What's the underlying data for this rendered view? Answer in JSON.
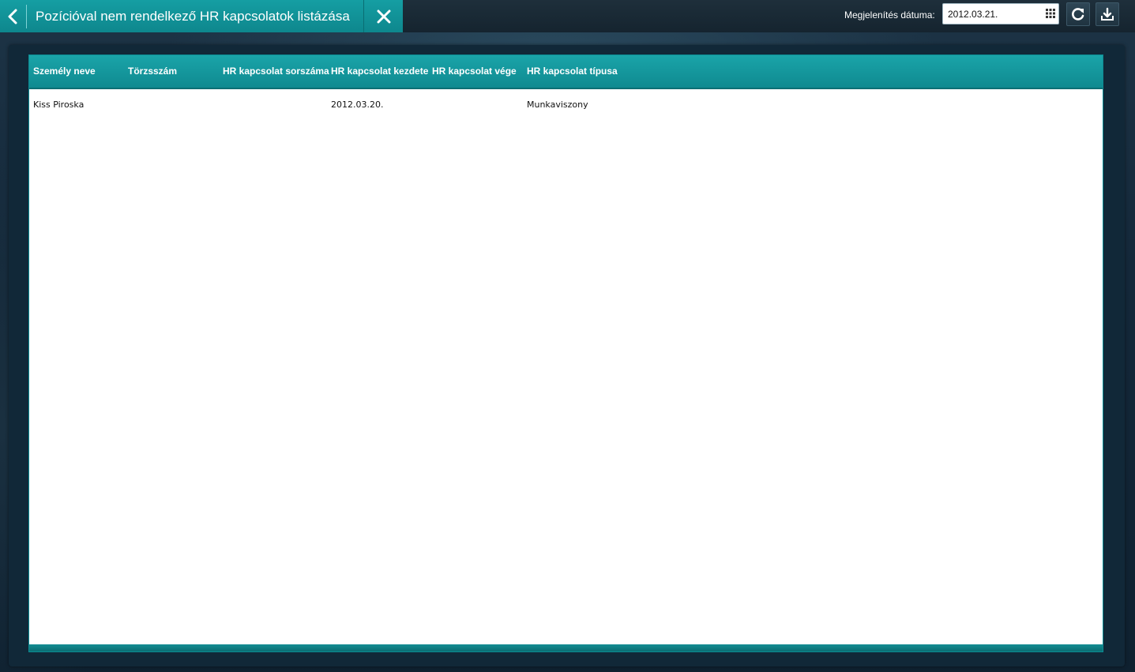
{
  "header": {
    "title": "Pozícióval nem rendelkező HR kapcsolatok listázása",
    "date_label": "Megjelenítés dátuma:",
    "date_value": "2012.03.21."
  },
  "icons": {
    "back": "chevron-left-icon",
    "close": "close-icon",
    "calendar": "calendar-icon",
    "refresh": "refresh-icon",
    "export": "download-icon"
  },
  "colors": {
    "accent": "#0f8a90",
    "panel": "#112838",
    "topbar": "#15242f"
  },
  "table": {
    "columns": [
      "Személy neve",
      "Törzsszám",
      "HR kapcsolat sorszáma",
      "HR kapcsolat kezdete",
      "HR kapcsolat vége",
      "HR kapcsolat típusa"
    ],
    "rows": [
      [
        "Kiss Piroska",
        "",
        "",
        "2012.03.20.",
        "",
        "Munkaviszony"
      ]
    ]
  }
}
